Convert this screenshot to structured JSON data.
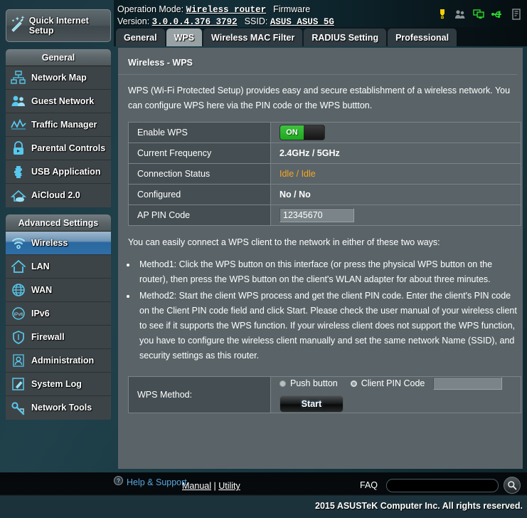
{
  "header": {
    "operation_mode_label": "Operation Mode:",
    "operation_mode_value": "Wireless router",
    "firmware_label": "Firmware",
    "version_label": "Version:",
    "version_value": "3.0.0.4.376_3792",
    "ssid_label": "SSID:",
    "ssid_value": "ASUS ASUS_5G",
    "icons": [
      {
        "name": "notification-bulb-icon",
        "color": "#f5d000"
      },
      {
        "name": "guest-network-users-icon",
        "color": "#8b9497"
      },
      {
        "name": "client-list-monitors-icon",
        "color": "#2fd62f"
      },
      {
        "name": "usb-device-icon",
        "color": "#2fd62f"
      },
      {
        "name": "system-log-icon",
        "color": "#8b9497"
      }
    ]
  },
  "sidebar": {
    "quick_setup": "Quick Internet Setup",
    "general_header": "General",
    "general_items": [
      {
        "label": "Network Map",
        "icon": "network-map-icon"
      },
      {
        "label": "Guest Network",
        "icon": "guest-network-icon"
      },
      {
        "label": "Traffic Manager",
        "icon": "traffic-manager-icon"
      },
      {
        "label": "Parental Controls",
        "icon": "parental-controls-lock-icon"
      },
      {
        "label": "USB Application",
        "icon": "usb-application-puzzle-icon"
      },
      {
        "label": "AiCloud 2.0",
        "icon": "aicloud-icon"
      }
    ],
    "advanced_header": "Advanced Settings",
    "advanced_items": [
      {
        "label": "Wireless",
        "icon": "wireless-signal-icon",
        "active": true
      },
      {
        "label": "LAN",
        "icon": "lan-home-icon",
        "active": false
      },
      {
        "label": "WAN",
        "icon": "wan-globe-icon",
        "active": false
      },
      {
        "label": "IPv6",
        "icon": "ipv6-icon",
        "active": false
      },
      {
        "label": "Firewall",
        "icon": "firewall-shield-icon",
        "active": false
      },
      {
        "label": "Administration",
        "icon": "administration-user-icon",
        "active": false
      },
      {
        "label": "System Log",
        "icon": "system-log-pencil-icon",
        "active": false
      },
      {
        "label": "Network Tools",
        "icon": "network-tools-wrench-icon",
        "active": false
      }
    ]
  },
  "tabs": [
    {
      "label": "General",
      "active": false
    },
    {
      "label": "WPS",
      "active": true
    },
    {
      "label": "Wireless MAC Filter",
      "active": false
    },
    {
      "label": "RADIUS Setting",
      "active": false
    },
    {
      "label": "Professional",
      "active": false
    }
  ],
  "panel": {
    "title": "Wireless - WPS",
    "description": "WPS (Wi-Fi Protected Setup) provides easy and secure establishment of a wireless network. You can configure WPS here via the PIN code or the WPS buttton.",
    "rows": [
      {
        "key": "Enable WPS",
        "type": "toggle",
        "value": "ON"
      },
      {
        "key": "Current Frequency",
        "type": "text",
        "value": "2.4GHz / 5GHz"
      },
      {
        "key": "Connection Status",
        "type": "status",
        "value": "Idle / Idle"
      },
      {
        "key": "Configured",
        "type": "text",
        "value": "No / No"
      },
      {
        "key": "AP PIN Code",
        "type": "input",
        "value": "12345670"
      }
    ],
    "howto_intro": "You can easily connect a WPS client to the network in either of these two ways:",
    "methods": [
      "Method1: Click the WPS button on this interface (or press the physical WPS button on the router), then press the WPS button on the client's WLAN adapter for about three minutes.",
      "Method2: Start the client WPS process and get the client PIN code. Enter the client's PIN code on the Client PIN code field and click Start. Please check the user manual of your wireless client to see if it supports the WPS function. If your wireless client does not support the WPS function, you have to configure the wireless client manually and set the same network Name (SSID), and security settings as this router."
    ],
    "wps_method_label": "WPS Method:",
    "radio_push_button": "Push button",
    "radio_client_pin": "Client PIN Code",
    "client_pin_value": "",
    "start_button": "Start"
  },
  "footer": {
    "help_support": "Help & Support",
    "manual": "Manual",
    "separator": "|",
    "utility": "Utility",
    "faq_label": "FAQ",
    "faq_value": "",
    "copyright": "2015 ASUSTeK Computer Inc. All rights reserved."
  },
  "colors": {
    "accent_blue": "#2a699f",
    "panel_bg": "#5a6468",
    "status_orange": "#f5a623",
    "toggle_green": "#1ea81e",
    "link_blue": "#5aa7e0"
  }
}
